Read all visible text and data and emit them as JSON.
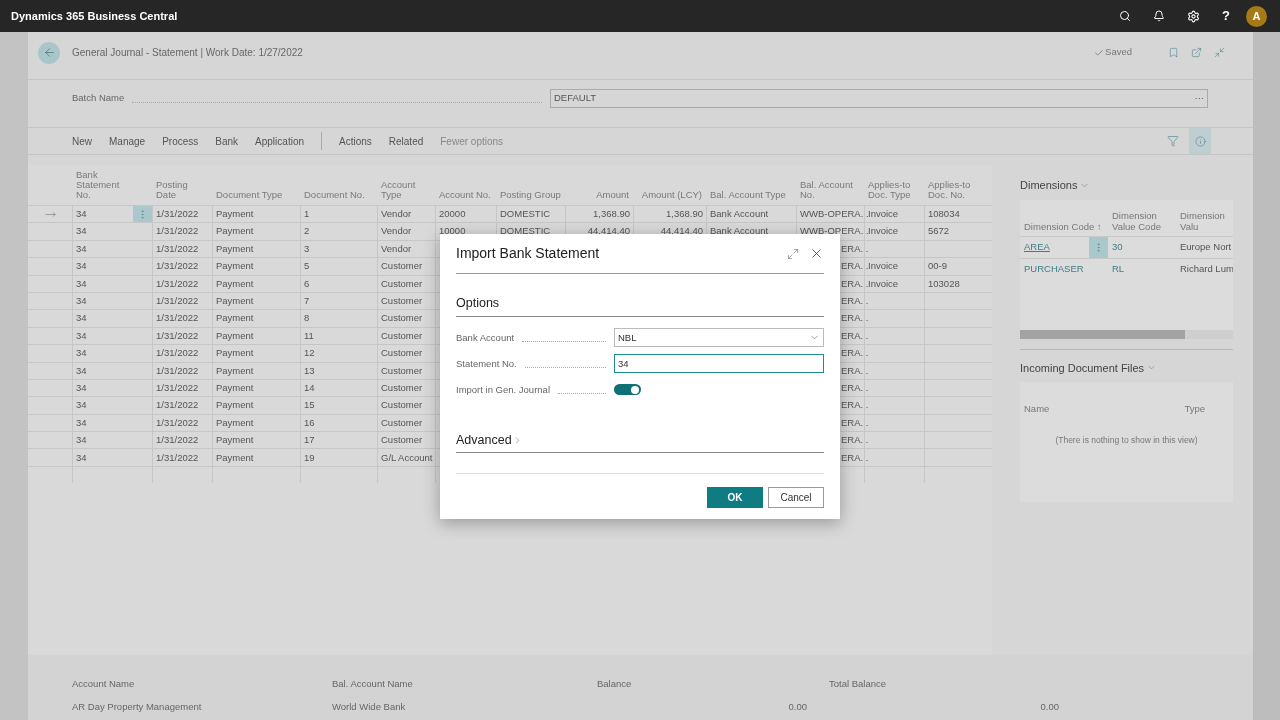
{
  "app_bar": {
    "title": "Dynamics 365 Business Central",
    "help": "?",
    "avatar": "A"
  },
  "page": {
    "title": "General Journal - Statement | Work Date: 1/27/2022",
    "status": "Saved"
  },
  "batch": {
    "label": "Batch Name",
    "value": "DEFAULT",
    "more": "···"
  },
  "actions": [
    {
      "label": "New",
      "kind": "action"
    },
    {
      "label": "Manage",
      "kind": "action"
    },
    {
      "label": "Process",
      "kind": "action"
    },
    {
      "label": "Bank",
      "kind": "action"
    },
    {
      "label": "Application",
      "kind": "action"
    },
    {
      "label": "Actions",
      "kind": "action"
    },
    {
      "label": "Related",
      "kind": "action"
    },
    {
      "label": "Fewer options",
      "kind": "toggle"
    }
  ],
  "journal": {
    "columns": [
      "Bank Statement No.",
      "Posting Date",
      "Document Type",
      "Document No.",
      "Account Type",
      "Account No.",
      "Posting Group",
      "Amount",
      "Amount (LCY)",
      "Bal. Account Type",
      "Bal. Account No.",
      "Applies-to Doc. Type",
      "Applies-to Doc. No."
    ],
    "rows": [
      {
        "selected": true,
        "covered": false,
        "cells": [
          "34",
          "1/31/2022",
          "Payment",
          "1",
          "Vendor",
          "20000",
          "DOMESTIC",
          "1,368.90",
          "1,368.90",
          "Bank Account",
          "WWB-OPERA...",
          "Invoice",
          "108034"
        ]
      },
      {
        "selected": false,
        "covered": false,
        "cells": [
          "34",
          "1/31/2022",
          "Payment",
          "2",
          "Vendor",
          "10000",
          "DOMESTIC",
          "44,414.40",
          "44,414.40",
          "Bank Account",
          "WWB-OPERA...",
          "Invoice",
          "5672"
        ]
      },
      {
        "selected": false,
        "covered": true,
        "cells": [
          "34",
          "1/31/2022",
          "Payment",
          "3",
          "Vendor",
          "ERA..."
        ]
      },
      {
        "selected": false,
        "covered": true,
        "cells": [
          "34",
          "1/31/2022",
          "Payment",
          "5",
          "Customer",
          "ERA...",
          "Invoice",
          "00-9"
        ]
      },
      {
        "selected": false,
        "covered": true,
        "cells": [
          "34",
          "1/31/2022",
          "Payment",
          "6",
          "Customer",
          "ERA...",
          "Invoice",
          "103028"
        ]
      },
      {
        "selected": false,
        "covered": true,
        "cells": [
          "34",
          "1/31/2022",
          "Payment",
          "7",
          "Customer",
          "ERA..."
        ]
      },
      {
        "selected": false,
        "covered": true,
        "cells": [
          "34",
          "1/31/2022",
          "Payment",
          "8",
          "Customer",
          "ERA..."
        ]
      },
      {
        "selected": false,
        "covered": true,
        "cells": [
          "34",
          "1/31/2022",
          "Payment",
          "11",
          "Customer",
          "ERA..."
        ]
      },
      {
        "selected": false,
        "covered": true,
        "cells": [
          "34",
          "1/31/2022",
          "Payment",
          "12",
          "Customer",
          "ERA..."
        ]
      },
      {
        "selected": false,
        "covered": true,
        "cells": [
          "34",
          "1/31/2022",
          "Payment",
          "13",
          "Customer",
          "ERA..."
        ]
      },
      {
        "selected": false,
        "covered": true,
        "cells": [
          "34",
          "1/31/2022",
          "Payment",
          "14",
          "Customer",
          "ERA..."
        ]
      },
      {
        "selected": false,
        "covered": true,
        "cells": [
          "34",
          "1/31/2022",
          "Payment",
          "15",
          "Customer",
          "ERA..."
        ]
      },
      {
        "selected": false,
        "covered": true,
        "cells": [
          "34",
          "1/31/2022",
          "Payment",
          "16",
          "Customer",
          "ERA..."
        ]
      },
      {
        "selected": false,
        "covered": true,
        "cells": [
          "34",
          "1/31/2022",
          "Payment",
          "17",
          "Customer",
          "ERA..."
        ]
      },
      {
        "selected": false,
        "covered": true,
        "cells": [
          "34",
          "1/31/2022",
          "Payment",
          "19",
          "G/L Account",
          "ERA..."
        ]
      },
      {
        "selected": false
      }
    ]
  },
  "dimensions": {
    "title": "Dimensions",
    "columns": [
      "Dimension Code ↑",
      "Dimension Value Code",
      "Dimension Valu"
    ],
    "rows": [
      {
        "selected": true,
        "code": "AREA",
        "value_code": "30",
        "value_name": "Europe Nort"
      },
      {
        "selected": false,
        "code": "PURCHASER",
        "value_code": "RL",
        "value_name": "Richard Lum"
      }
    ]
  },
  "incoming_documents": {
    "title": "Incoming Document Files",
    "columns": [
      "Name",
      "Type"
    ],
    "empty_text": "(There is nothing to show in this view)"
  },
  "totals": [
    {
      "label": "Account Name",
      "value": "AR Day Property Management"
    },
    {
      "label": "Bal. Account Name",
      "value": "World Wide Bank"
    },
    {
      "label": "Balance",
      "value": "0.00"
    },
    {
      "label": "Total Balance",
      "value": "0.00"
    }
  ],
  "dialog": {
    "title": "Import Bank Statement",
    "section": "Options",
    "fields": [
      {
        "kind": "dropdown",
        "label": "Bank Account",
        "value": "NBL",
        "focused": false
      },
      {
        "kind": "text",
        "label": "Statement No.",
        "value": "34",
        "focused": true
      },
      {
        "kind": "toggle",
        "label": "Import in Gen. Journal",
        "on": true
      }
    ],
    "advanced": {
      "label": "Advanced",
      "expanded": false
    },
    "buttons": [
      {
        "label": "OK",
        "kind": "primary"
      },
      {
        "label": "Cancel",
        "kind": "secondary"
      }
    ]
  }
}
